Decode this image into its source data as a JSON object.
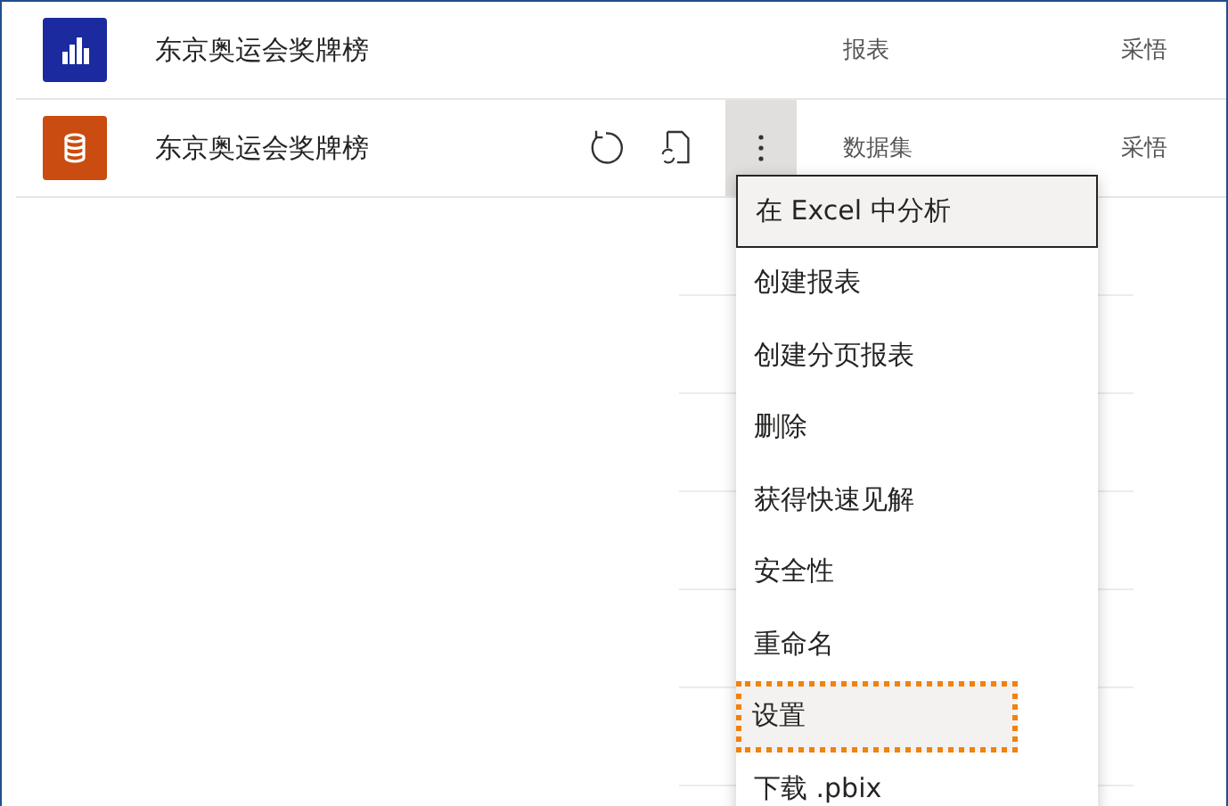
{
  "rows": [
    {
      "name": "东京奥运会奖牌榜",
      "kind": "report",
      "type": "报表",
      "owner": "采悟",
      "show_actions": false
    },
    {
      "name": "东京奥运会奖牌榜",
      "kind": "dataset",
      "type": "数据集",
      "owner": "采悟",
      "show_actions": true
    }
  ],
  "context_menu": {
    "items": [
      {
        "label": "在 Excel 中分析",
        "focused": true,
        "highlighted": false
      },
      {
        "label": "创建报表",
        "focused": false,
        "highlighted": false
      },
      {
        "label": "创建分页报表",
        "focused": false,
        "highlighted": false
      },
      {
        "label": "删除",
        "focused": false,
        "highlighted": false
      },
      {
        "label": "获得快速见解",
        "focused": false,
        "highlighted": false
      },
      {
        "label": "安全性",
        "focused": false,
        "highlighted": false
      },
      {
        "label": "重命名",
        "focused": false,
        "highlighted": false
      },
      {
        "label": "设置",
        "focused": false,
        "highlighted": true
      },
      {
        "label": "下载 .pbix",
        "focused": false,
        "highlighted": false
      }
    ]
  }
}
